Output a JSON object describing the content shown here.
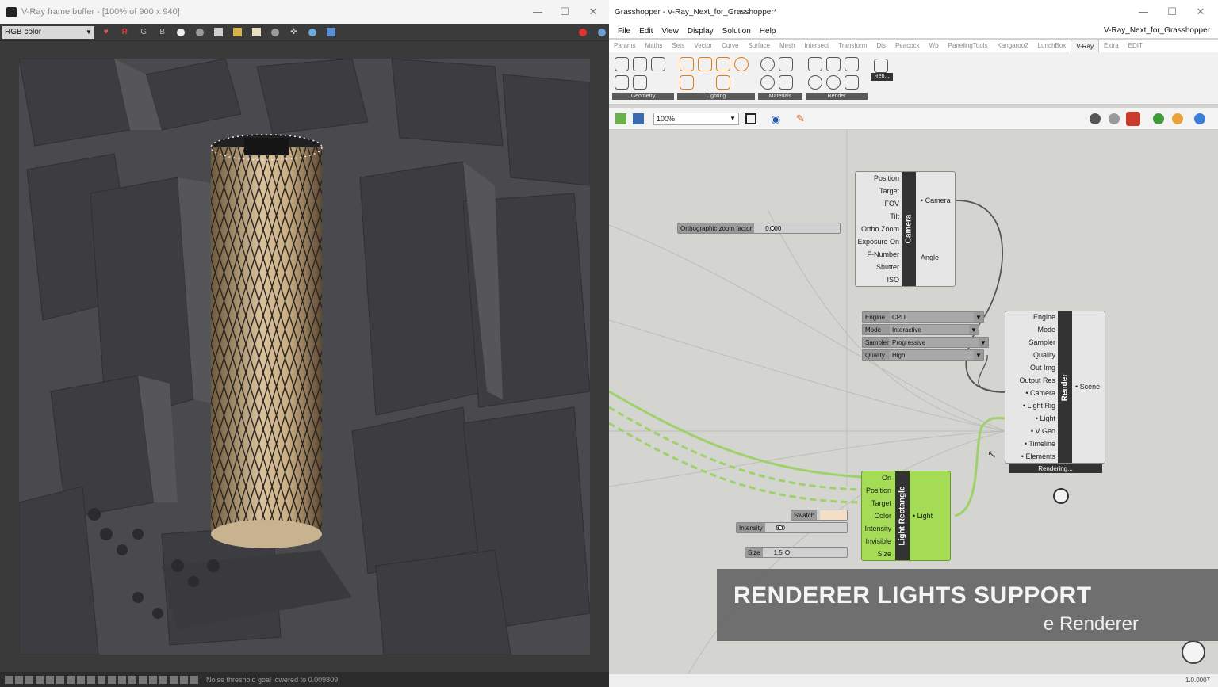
{
  "vfb": {
    "title": "V-Ray frame buffer - [100% of 900 x 940]",
    "channel": "RGB color",
    "toolbar": {
      "r": "R",
      "g": "G",
      "b": "B"
    },
    "status": "Noise threshold goal lowered to 0.009809"
  },
  "window_controls": {
    "minimize": "—",
    "maximize": "☐",
    "close": "✕"
  },
  "gh": {
    "title": "Grasshopper - V-Ray_Next_for_Grasshopper*",
    "document": "V-Ray_Next_for_Grasshopper",
    "menu": [
      "File",
      "Edit",
      "View",
      "Display",
      "Solution",
      "Help"
    ],
    "tabs": [
      "Params",
      "Maths",
      "Sets",
      "Vector",
      "Curve",
      "Surface",
      "Mesh",
      "Intersect",
      "Transform",
      "Dis",
      "Peacock",
      "Wb",
      "PanelingTools",
      "Kangaroo2",
      "LunchBox",
      "V-Ray",
      "Extra",
      "EDIT"
    ],
    "active_tab": "V-Ray",
    "ribbon_groups": [
      "Geometry",
      "Lighting",
      "Materials",
      "Render"
    ],
    "ribbon_last_icon": "Ren...",
    "zoom": "100%",
    "version": "1.0.0007",
    "camera": {
      "label": "Camera",
      "inputs": [
        "Position",
        "Target",
        "FOV",
        "Tilt",
        "Ortho Zoom",
        "Exposure On",
        "F-Number",
        "Shutter",
        "ISO"
      ],
      "outputs": [
        "Camera",
        "Angle"
      ]
    },
    "ortho_slider": {
      "label": "Orthographic zoom factor",
      "value": "0.000"
    },
    "render": {
      "label": "Render",
      "inputs": [
        "Engine",
        "Mode",
        "Sampler",
        "Quality",
        "Out Img",
        "Output Res",
        "Camera",
        "Light Rig",
        "Light",
        "V Geo",
        "Timeline",
        "Elements"
      ],
      "output": "Scene",
      "status": "Rendering..."
    },
    "value_lists": [
      {
        "key": "Engine",
        "value": "CPU"
      },
      {
        "key": "Mode",
        "value": "Interactive"
      },
      {
        "key": "Sampler",
        "value": "Progressive"
      },
      {
        "key": "Quality",
        "value": "High"
      }
    ],
    "light": {
      "label": "Light Rectangle",
      "inputs": [
        "On",
        "Position",
        "Target",
        "Color",
        "Intensity",
        "Invisible",
        "Size"
      ],
      "output": "Light"
    },
    "swatch": {
      "label": "Swatch",
      "color": "#f3dfc6"
    },
    "intensity_slider": {
      "label": "Intensity",
      "value": "5.0"
    },
    "size_slider": {
      "label": "Size",
      "value": "1.5"
    },
    "overlay": {
      "title": "RENDERER LIGHTS SUPPORT",
      "subtitle": "e Renderer"
    }
  }
}
